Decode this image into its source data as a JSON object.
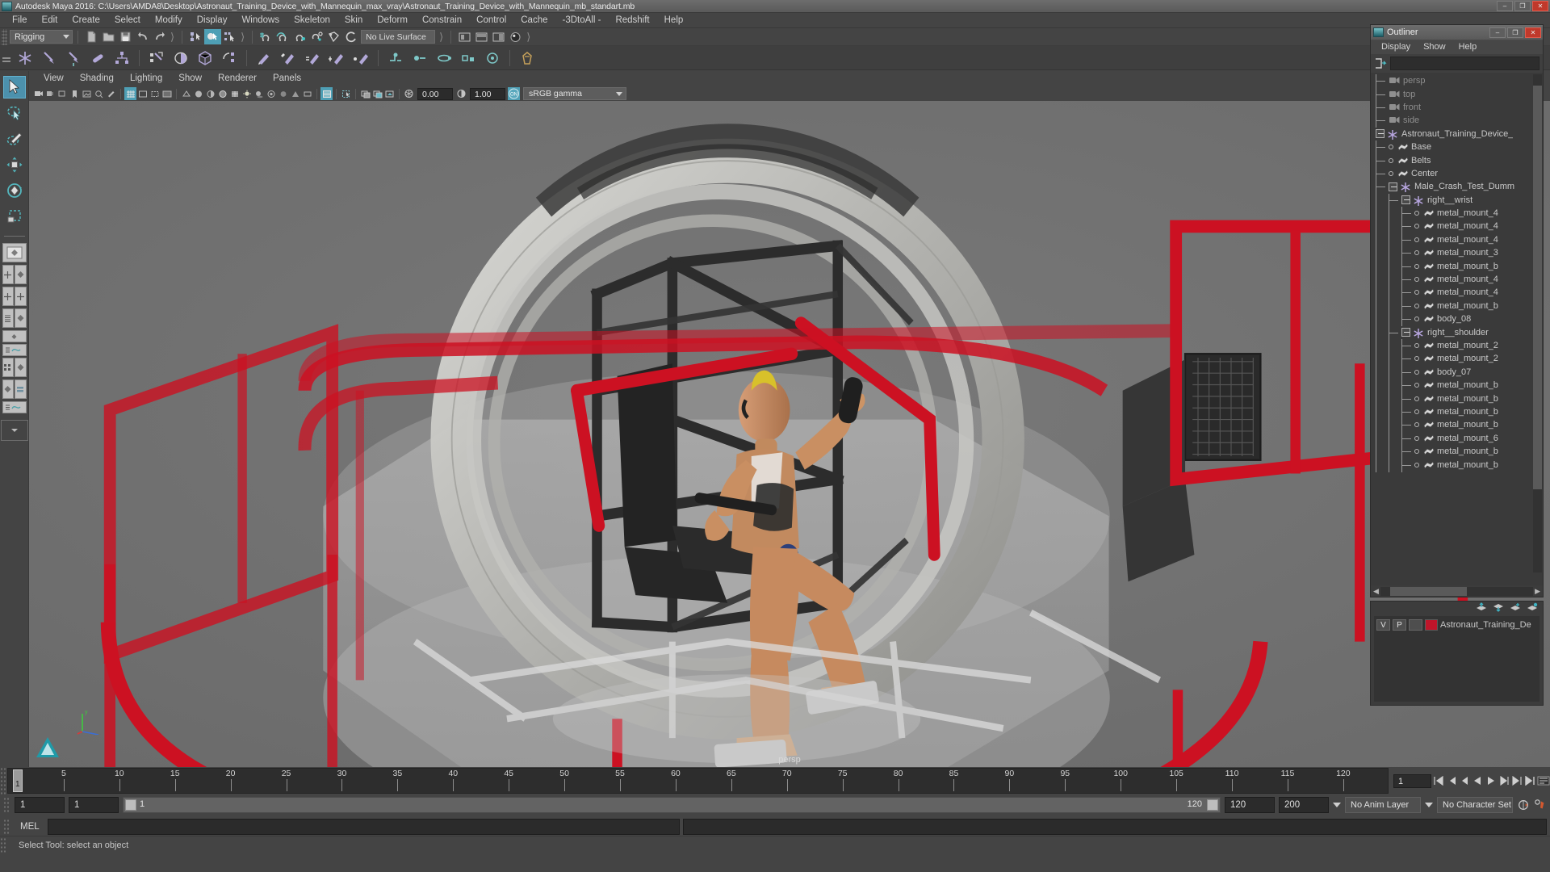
{
  "window": {
    "app_title": "Autodesk Maya 2016: C:\\Users\\AMDA8\\Desktop\\Astronaut_Training_Device_with_Mannequin_max_vray\\Astronaut_Training_Device_with_Mannequin_mb_standart.mb",
    "minimize_label": "–",
    "maximize_label": "❐",
    "close_label": "✕"
  },
  "menubar": {
    "items": [
      {
        "label": "File"
      },
      {
        "label": "Edit"
      },
      {
        "label": "Create"
      },
      {
        "label": "Select"
      },
      {
        "label": "Modify"
      },
      {
        "label": "Display"
      },
      {
        "label": "Windows"
      },
      {
        "label": "Skeleton"
      },
      {
        "label": "Skin"
      },
      {
        "label": "Deform"
      },
      {
        "label": "Constrain"
      },
      {
        "label": "Control"
      },
      {
        "label": "Cache"
      },
      {
        "label": "-3DtoAll -"
      },
      {
        "label": "Redshift"
      },
      {
        "label": "Help"
      }
    ]
  },
  "statusline": {
    "menu_set": "Rigging",
    "live_surface": "No Live Surface",
    "icons": [
      "new-scene-icon",
      "open-scene-icon",
      "save-scene-icon",
      "undo-icon",
      "redo-icon",
      "select-by-hierarchy-icon",
      "select-by-object-icon",
      "select-by-component-icon",
      "snap-to-grid-icon",
      "snap-to-curve-icon",
      "snap-to-point-icon",
      "snap-to-projected-center-icon",
      "snap-to-view-plane-icon",
      "make-live-icon"
    ]
  },
  "shelf": {
    "icons": [
      "joint-tool-icon",
      "ik-handle-icon",
      "ik-spline-handle-icon",
      "insert-joint-icon",
      "mirror-joint-icon",
      "bind-skin-icon",
      "smooth-bind-icon",
      "interactive-bind-icon",
      "detach-skin-icon",
      "paint-weights-icon",
      "copy-weights-icon",
      "mirror-weights-icon",
      "prune-weights-icon",
      "hammer-weights-icon",
      "weight-hammer-icon",
      "parent-constraint-icon",
      "point-constraint-icon",
      "orient-constraint-icon",
      "aim-constraint-icon",
      "scale-constraint-icon",
      "pole-vector-icon",
      "character-set-icon"
    ]
  },
  "toolbox": {
    "tools": [
      {
        "name": "select-tool",
        "selected": true
      },
      {
        "name": "lasso-select-tool",
        "selected": false
      },
      {
        "name": "paint-select-tool",
        "selected": false
      },
      {
        "name": "move-tool",
        "selected": false
      },
      {
        "name": "rotate-tool",
        "selected": false
      },
      {
        "name": "scale-tool",
        "selected": false
      }
    ],
    "layouts": [
      "single-perspective-layout",
      "four-view-layout",
      "outliner-persp-layout",
      "hypergraph-persp-layout",
      "persp-graph-editor-layout",
      "hypershade-persp-layout",
      "persp-outliner-graph-layout",
      "more-layouts"
    ]
  },
  "viewport": {
    "menus": [
      {
        "label": "View"
      },
      {
        "label": "Shading"
      },
      {
        "label": "Lighting"
      },
      {
        "label": "Show"
      },
      {
        "label": "Renderer"
      },
      {
        "label": "Panels"
      }
    ],
    "exposure": "0.00",
    "gamma": "1.00",
    "color_management": "sRGB gamma",
    "cm_toggle": "ON",
    "camera_label": "persp",
    "axis_labels": {
      "y": "y",
      "x": "x",
      "z": "z"
    },
    "background_color": "#717171",
    "scene_colors": {
      "red_railing": "#cc1122",
      "metal_ring": "#b9b9b7",
      "black_frame": "#2e2e2e",
      "dummy_skin": "#c68a62",
      "floor_panel": "#b0b0b0"
    }
  },
  "outliner": {
    "title": "Outliner",
    "menus": [
      {
        "label": "Display"
      },
      {
        "label": "Show"
      },
      {
        "label": "Help"
      }
    ],
    "search_value": "",
    "search_placeholder": "",
    "rows": [
      {
        "label": "persp",
        "indent": 1,
        "type": "camera",
        "dim": true,
        "expand": false,
        "dot": false
      },
      {
        "label": "top",
        "indent": 1,
        "type": "camera",
        "dim": true,
        "expand": false,
        "dot": false
      },
      {
        "label": "front",
        "indent": 1,
        "type": "camera",
        "dim": true,
        "expand": false,
        "dot": false
      },
      {
        "label": "side",
        "indent": 1,
        "type": "camera",
        "dim": true,
        "expand": false,
        "dot": false
      },
      {
        "label": "Astronaut_Training_Device_",
        "indent": 0,
        "type": "group",
        "dim": false,
        "expand": true,
        "dot": false
      },
      {
        "label": "Base",
        "indent": 1,
        "type": "mesh",
        "dim": false,
        "expand": false,
        "dot": true
      },
      {
        "label": "Belts",
        "indent": 1,
        "type": "mesh",
        "dim": false,
        "expand": false,
        "dot": true
      },
      {
        "label": "Center",
        "indent": 1,
        "type": "mesh",
        "dim": false,
        "expand": false,
        "dot": true
      },
      {
        "label": "Male_Crash_Test_Dumm",
        "indent": 1,
        "type": "group",
        "dim": false,
        "expand": true,
        "dot": false
      },
      {
        "label": "right__wrist",
        "indent": 2,
        "type": "group",
        "dim": false,
        "expand": true,
        "dot": false
      },
      {
        "label": "metal_mount_4",
        "indent": 3,
        "type": "mesh",
        "dim": false,
        "expand": false,
        "dot": true
      },
      {
        "label": "metal_mount_4",
        "indent": 3,
        "type": "mesh",
        "dim": false,
        "expand": false,
        "dot": true
      },
      {
        "label": "metal_mount_4",
        "indent": 3,
        "type": "mesh",
        "dim": false,
        "expand": false,
        "dot": true
      },
      {
        "label": "metal_mount_3",
        "indent": 3,
        "type": "mesh",
        "dim": false,
        "expand": false,
        "dot": true
      },
      {
        "label": "metal_mount_b",
        "indent": 3,
        "type": "mesh",
        "dim": false,
        "expand": false,
        "dot": true
      },
      {
        "label": "metal_mount_4",
        "indent": 3,
        "type": "mesh",
        "dim": false,
        "expand": false,
        "dot": true
      },
      {
        "label": "metal_mount_4",
        "indent": 3,
        "type": "mesh",
        "dim": false,
        "expand": false,
        "dot": true
      },
      {
        "label": "metal_mount_b",
        "indent": 3,
        "type": "mesh",
        "dim": false,
        "expand": false,
        "dot": true
      },
      {
        "label": "body_08",
        "indent": 3,
        "type": "mesh",
        "dim": false,
        "expand": false,
        "dot": true
      },
      {
        "label": "right__shoulder",
        "indent": 2,
        "type": "group",
        "dim": false,
        "expand": true,
        "dot": false
      },
      {
        "label": "metal_mount_2",
        "indent": 3,
        "type": "mesh",
        "dim": false,
        "expand": false,
        "dot": true
      },
      {
        "label": "metal_mount_2",
        "indent": 3,
        "type": "mesh",
        "dim": false,
        "expand": false,
        "dot": true
      },
      {
        "label": "body_07",
        "indent": 3,
        "type": "mesh",
        "dim": false,
        "expand": false,
        "dot": true
      },
      {
        "label": "metal_mount_b",
        "indent": 3,
        "type": "mesh",
        "dim": false,
        "expand": false,
        "dot": true
      },
      {
        "label": "metal_mount_b",
        "indent": 3,
        "type": "mesh",
        "dim": false,
        "expand": false,
        "dot": true
      },
      {
        "label": "metal_mount_b",
        "indent": 3,
        "type": "mesh",
        "dim": false,
        "expand": false,
        "dot": true
      },
      {
        "label": "metal_mount_b",
        "indent": 3,
        "type": "mesh",
        "dim": false,
        "expand": false,
        "dot": true
      },
      {
        "label": "metal_mount_6",
        "indent": 3,
        "type": "mesh",
        "dim": false,
        "expand": false,
        "dot": true
      },
      {
        "label": "metal_mount_b",
        "indent": 3,
        "type": "mesh",
        "dim": false,
        "expand": false,
        "dot": true
      },
      {
        "label": "metal_mount_b",
        "indent": 3,
        "type": "mesh",
        "dim": false,
        "expand": false,
        "dot": true
      }
    ]
  },
  "layer_editor": {
    "visibility_label": "V",
    "playback_label": "P",
    "layer_name": "Astronaut_Training_De",
    "layer_color": "#c0152a",
    "tool_icons": [
      "move-layer-up-icon",
      "move-layer-down-icon",
      "new-layer-icon",
      "new-layer-from-selected-icon"
    ]
  },
  "timeline": {
    "ticks": [
      5,
      10,
      15,
      20,
      25,
      30,
      35,
      40,
      45,
      50,
      55,
      60,
      65,
      70,
      75,
      80,
      85,
      90,
      95,
      100,
      105,
      110,
      115,
      120
    ],
    "current_frame": "1",
    "range_start": "1",
    "range_end": "120",
    "anim_start": "1",
    "anim_end": "120",
    "playback_end": "200",
    "frame_field": "1",
    "playback_icons": [
      "go-to-start-icon",
      "step-back-key-icon",
      "step-back-frame-icon",
      "play-backwards-icon",
      "play-forwards-icon",
      "step-forward-frame-icon",
      "step-forward-key-icon",
      "go-to-end-icon"
    ],
    "anim_layer": "No Anim Layer",
    "character_set": "No Character Set",
    "auto_key_icon": "auto-keyframe-icon",
    "anim_prefs_icon": "animation-preferences-icon"
  },
  "command_line": {
    "mel_label": "MEL",
    "mel_input": "",
    "output": ""
  },
  "help_line": {
    "text": "Select Tool: select an object"
  }
}
